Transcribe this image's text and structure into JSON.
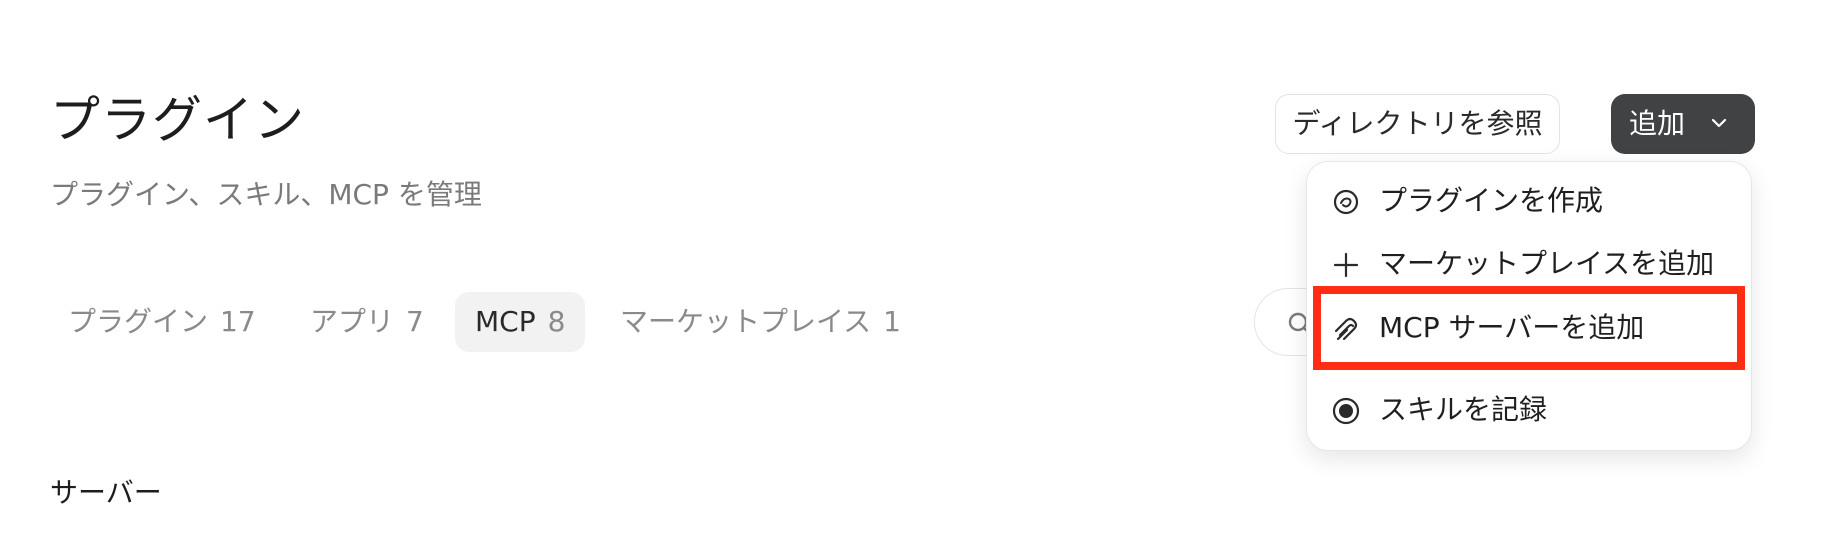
{
  "header": {
    "title": "プラグイン",
    "subtitle": "プラグイン、スキル、MCP を管理",
    "browse_directory_label": "ディレクトリを参照",
    "add_label": "追加"
  },
  "tabs": [
    {
      "label": "プラグイン",
      "count": "17"
    },
    {
      "label": "アプリ",
      "count": "7"
    },
    {
      "label": "MCP",
      "count": "8"
    },
    {
      "label": "マーケットプレイス",
      "count": "1"
    }
  ],
  "active_tab": "MCP",
  "section": {
    "heading": "サーバー"
  },
  "add_menu": {
    "items": [
      {
        "label": "プラグインを作成",
        "icon": "create-plugin-icon"
      },
      {
        "label": "マーケットプレイスを追加",
        "icon": "plus-icon"
      },
      {
        "label": "MCP サーバーを追加",
        "icon": "mcp-icon"
      },
      {
        "label": "スキルを記録",
        "icon": "record-icon"
      }
    ],
    "highlighted_item": "MCP サーバーを追加"
  },
  "colors": {
    "accent_button": "#414244",
    "highlight": "#ff2d12",
    "muted_text": "#8a8a8a"
  }
}
